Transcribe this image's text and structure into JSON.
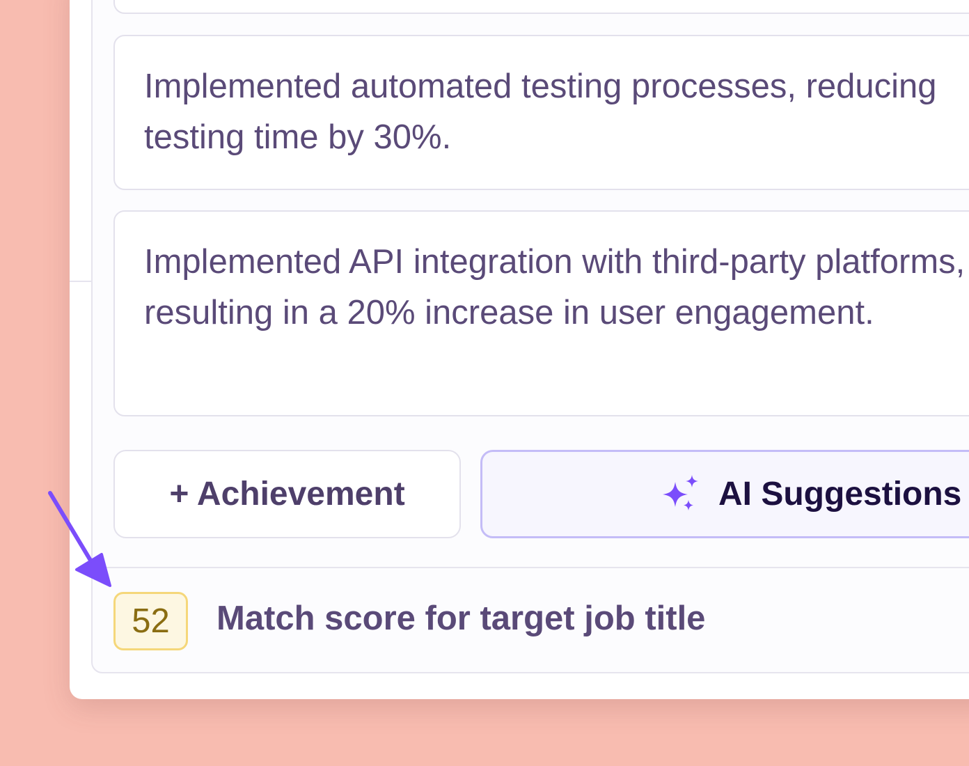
{
  "achievements": {
    "items": [
      {
        "line1": "Implemented automated testing processes, reducing",
        "line2": "testing time by 30%."
      },
      {
        "line1": "Implemented API integration with third-party platforms,",
        "line2": "resulting in a 20% increase in user engagement."
      }
    ],
    "add_button_label": "+ Achievement",
    "ai_button_label": "AI Suggestions",
    "ai_icon": "sparkles-icon"
  },
  "match_score": {
    "value": "52",
    "label": "Match score for target job title"
  },
  "colors": {
    "background": "#f8bcb0",
    "text": "#5a4a78",
    "ai_border": "#c4bcf7",
    "ai_icon": "#7b4dfb",
    "arrow": "#7b4dfb",
    "score_badge_bg": "#fdf7e2",
    "score_badge_border": "#f5d77a",
    "score_text": "#8a6d12"
  }
}
